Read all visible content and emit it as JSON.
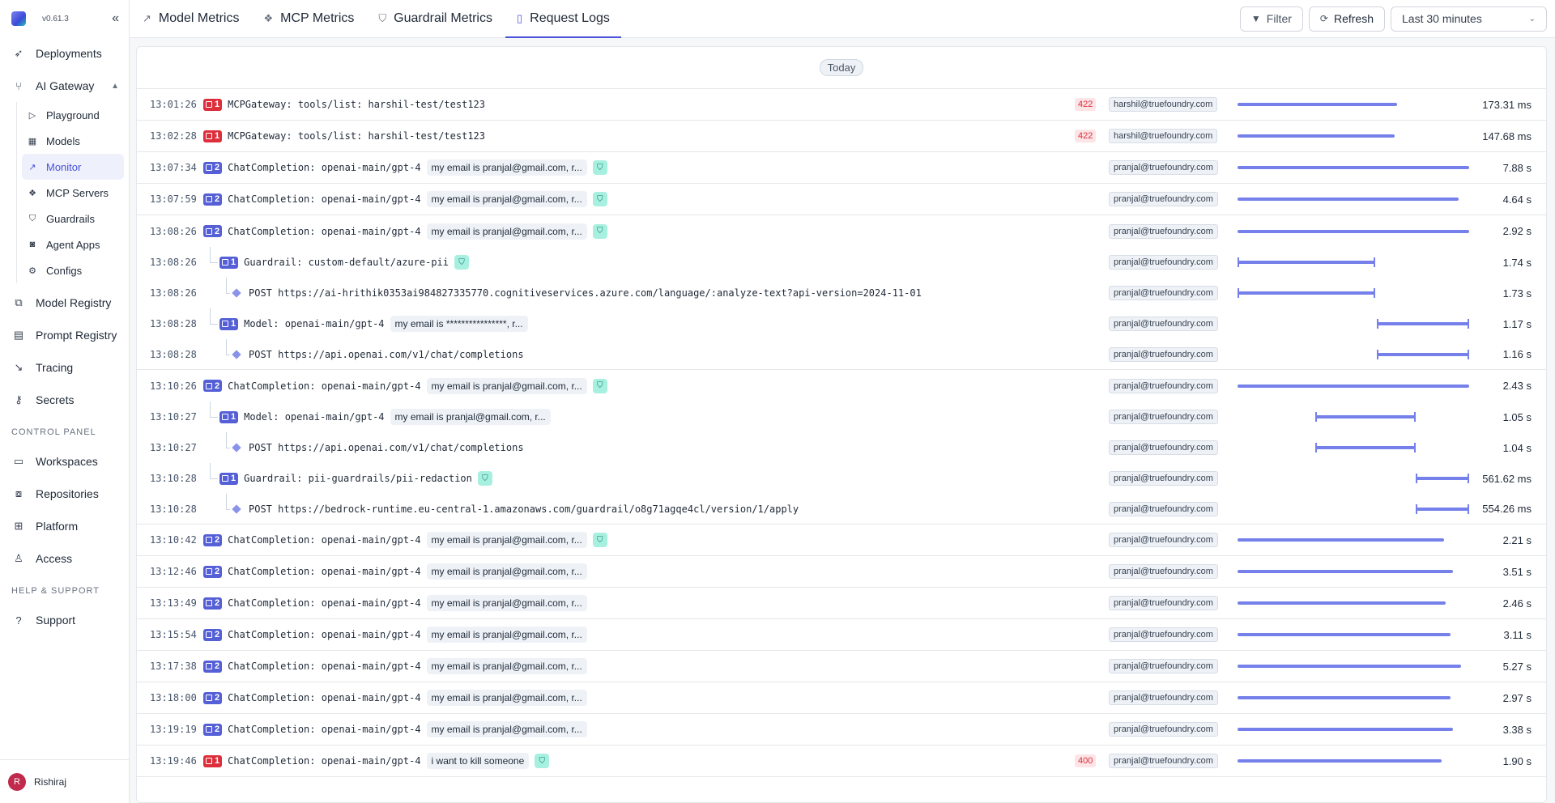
{
  "app": {
    "version": "v0.61.3"
  },
  "sidebar": {
    "items": [
      {
        "label": "Deployments"
      },
      {
        "label": "AI Gateway"
      },
      {
        "label": "Model Registry"
      },
      {
        "label": "Prompt Registry"
      },
      {
        "label": "Tracing"
      },
      {
        "label": "Secrets"
      }
    ],
    "subitems": [
      {
        "label": "Playground"
      },
      {
        "label": "Models"
      },
      {
        "label": "Monitor"
      },
      {
        "label": "MCP Servers"
      },
      {
        "label": "Guardrails"
      },
      {
        "label": "Agent Apps"
      },
      {
        "label": "Configs"
      }
    ],
    "control_panel_label": "CONTROL PANEL",
    "control_items": [
      {
        "label": "Workspaces"
      },
      {
        "label": "Repositories"
      },
      {
        "label": "Platform"
      },
      {
        "label": "Access"
      }
    ],
    "help_label": "HELP & SUPPORT",
    "support_label": "Support",
    "user": {
      "initial": "R",
      "name": "Rishiraj"
    }
  },
  "tabs": [
    {
      "label": "Model Metrics"
    },
    {
      "label": "MCP Metrics"
    },
    {
      "label": "Guardrail Metrics"
    },
    {
      "label": "Request Logs"
    }
  ],
  "toolbar": {
    "filter_label": "Filter",
    "refresh_label": "Refresh",
    "time_range": "Last 30 minutes"
  },
  "logs": {
    "day_label": "Today",
    "rows": [
      {
        "time": "13:01:26",
        "count": "1",
        "kind": "err",
        "name": "MCPGateway: tools/list: harshil-test/test123",
        "status": "422",
        "email": "harshil@truefoundry.com",
        "start": 0.0,
        "end": 0.69,
        "duration": "173.31 ms"
      },
      {
        "time": "13:02:28",
        "count": "1",
        "kind": "err",
        "name": "MCPGateway: tools/list: harshil-test/test123",
        "status": "422",
        "email": "harshil@truefoundry.com",
        "start": 0.0,
        "end": 0.68,
        "duration": "147.68 ms"
      },
      {
        "time": "13:07:34",
        "count": "2",
        "kind": "ok",
        "name": "ChatCompletion: openai-main/gpt-4",
        "message": "my email is pranjal@gmail.com, r...",
        "guard": true,
        "email": "pranjal@truefoundry.com",
        "start": 0.0,
        "end": 1.0,
        "duration": "7.88 s"
      },
      {
        "time": "13:07:59",
        "count": "2",
        "kind": "ok",
        "name": "ChatCompletion: openai-main/gpt-4",
        "message": "my email is pranjal@gmail.com, r...",
        "guard": true,
        "email": "pranjal@truefoundry.com",
        "start": 0.0,
        "end": 0.955,
        "duration": "4.64 s"
      },
      {
        "time": "13:08:26",
        "count": "2",
        "kind": "ok",
        "name": "ChatCompletion: openai-main/gpt-4",
        "message": "my email is pranjal@gmail.com, r...",
        "guard": true,
        "email": "pranjal@truefoundry.com",
        "start": 0.0,
        "end": 1.0,
        "duration": "2.92 s"
      },
      {
        "time": "13:08:26",
        "count": "1",
        "kind": "ok",
        "level": 1,
        "name": "Guardrail: custom-default/azure-pii",
        "guard": true,
        "email": "pranjal@truefoundry.com",
        "start": 0.0,
        "end": 0.596,
        "duration": "1.74 s"
      },
      {
        "time": "13:08:26",
        "level": 2,
        "name": "POST https://ai-hrithik0353ai984827335770.cognitiveservices.azure.com/language/:analyze-text?api-version=2024-11-01",
        "email": "pranjal@truefoundry.com",
        "start": 0.0,
        "end": 0.596,
        "duration": "1.73 s"
      },
      {
        "time": "13:08:28",
        "count": "1",
        "kind": "ok",
        "level": 1,
        "name": "Model: openai-main/gpt-4",
        "message": "my email is ****************, r...",
        "email": "pranjal@truefoundry.com",
        "start": 0.6,
        "end": 1.0,
        "duration": "1.17 s"
      },
      {
        "time": "13:08:28",
        "level": 2,
        "name": "POST https://api.openai.com/v1/chat/completions",
        "email": "pranjal@truefoundry.com",
        "start": 0.6,
        "end": 1.0,
        "duration": "1.16 s"
      },
      {
        "time": "13:10:26",
        "count": "2",
        "kind": "ok",
        "name": "ChatCompletion: openai-main/gpt-4",
        "message": "my email is pranjal@gmail.com, r...",
        "guard": true,
        "email": "pranjal@truefoundry.com",
        "start": 0.0,
        "end": 1.0,
        "duration": "2.43 s"
      },
      {
        "time": "13:10:27",
        "count": "1",
        "kind": "ok",
        "level": 1,
        "name": "Model: openai-main/gpt-4",
        "message": "my email is pranjal@gmail.com, r...",
        "email": "pranjal@truefoundry.com",
        "start": 0.335,
        "end": 0.77,
        "duration": "1.05 s"
      },
      {
        "time": "13:10:27",
        "level": 2,
        "name": "POST https://api.openai.com/v1/chat/completions",
        "email": "pranjal@truefoundry.com",
        "start": 0.335,
        "end": 0.77,
        "duration": "1.04 s"
      },
      {
        "time": "13:10:28",
        "count": "1",
        "kind": "ok",
        "level": 1,
        "name": "Guardrail: pii-guardrails/pii-redaction",
        "guard": true,
        "email": "pranjal@truefoundry.com",
        "start": 0.77,
        "end": 1.0,
        "duration": "561.62 ms"
      },
      {
        "time": "13:10:28",
        "level": 2,
        "name": "POST https://bedrock-runtime.eu-central-1.amazonaws.com/guardrail/o8g71agqe4cl/version/1/apply",
        "email": "pranjal@truefoundry.com",
        "start": 0.77,
        "end": 1.0,
        "duration": "554.26 ms"
      },
      {
        "time": "13:10:42",
        "count": "2",
        "kind": "ok",
        "name": "ChatCompletion: openai-main/gpt-4",
        "message": "my email is pranjal@gmail.com, r...",
        "guard": true,
        "email": "pranjal@truefoundry.com",
        "start": 0.0,
        "end": 0.89,
        "duration": "2.21 s"
      },
      {
        "time": "13:12:46",
        "count": "2",
        "kind": "ok",
        "name": "ChatCompletion: openai-main/gpt-4",
        "message": "my email is pranjal@gmail.com, r...",
        "email": "pranjal@truefoundry.com",
        "start": 0.0,
        "end": 0.93,
        "duration": "3.51 s"
      },
      {
        "time": "13:13:49",
        "count": "2",
        "kind": "ok",
        "name": "ChatCompletion: openai-main/gpt-4",
        "message": "my email is pranjal@gmail.com, r...",
        "email": "pranjal@truefoundry.com",
        "start": 0.0,
        "end": 0.9,
        "duration": "2.46 s"
      },
      {
        "time": "13:15:54",
        "count": "2",
        "kind": "ok",
        "name": "ChatCompletion: openai-main/gpt-4",
        "message": "my email is pranjal@gmail.com, r...",
        "email": "pranjal@truefoundry.com",
        "start": 0.0,
        "end": 0.92,
        "duration": "3.11 s"
      },
      {
        "time": "13:17:38",
        "count": "2",
        "kind": "ok",
        "name": "ChatCompletion: openai-main/gpt-4",
        "message": "my email is pranjal@gmail.com, r...",
        "email": "pranjal@truefoundry.com",
        "start": 0.0,
        "end": 0.965,
        "duration": "5.27 s"
      },
      {
        "time": "13:18:00",
        "count": "2",
        "kind": "ok",
        "name": "ChatCompletion: openai-main/gpt-4",
        "message": "my email is pranjal@gmail.com, r...",
        "email": "pranjal@truefoundry.com",
        "start": 0.0,
        "end": 0.92,
        "duration": "2.97 s"
      },
      {
        "time": "13:19:19",
        "count": "2",
        "kind": "ok",
        "name": "ChatCompletion: openai-main/gpt-4",
        "message": "my email is pranjal@gmail.com, r...",
        "email": "pranjal@truefoundry.com",
        "start": 0.0,
        "end": 0.93,
        "duration": "3.38 s"
      },
      {
        "time": "13:19:46",
        "count": "1",
        "kind": "err",
        "name": "ChatCompletion: openai-main/gpt-4",
        "message": "i want to kill someone",
        "guard": true,
        "status": "400",
        "email": "pranjal@truefoundry.com",
        "start": 0.0,
        "end": 0.88,
        "duration": "1.90 s"
      }
    ]
  }
}
